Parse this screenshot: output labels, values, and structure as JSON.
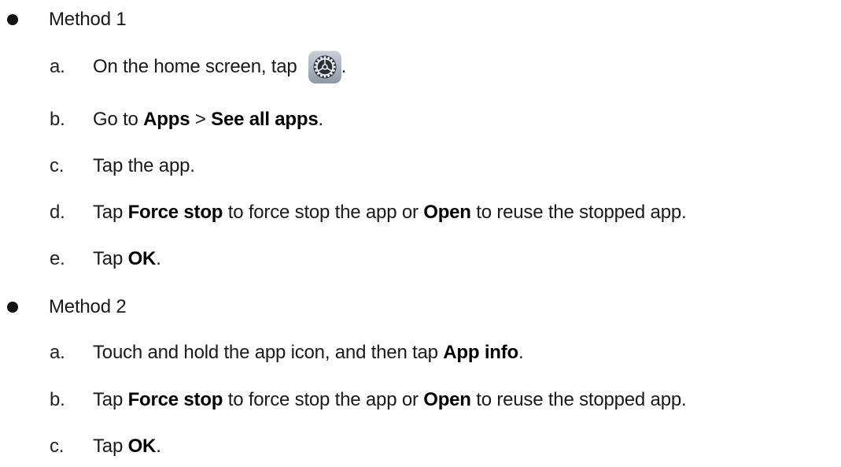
{
  "method1": {
    "label": "Method 1",
    "steps": [
      {
        "marker": "a.",
        "text": "On the home screen, tap",
        "after_icon": ".",
        "icon": "settings-icon"
      },
      {
        "marker": "b.",
        "parts": [
          "Go to ",
          "Apps",
          " > ",
          "See all apps",
          "."
        ]
      },
      {
        "marker": "c.",
        "text": "Tap the app."
      },
      {
        "marker": "d.",
        "parts": [
          "Tap ",
          "Force stop",
          " to force stop the app or ",
          "Open",
          " to reuse the stopped app."
        ]
      },
      {
        "marker": "e.",
        "parts": [
          "Tap ",
          "OK",
          "."
        ]
      }
    ]
  },
  "method2": {
    "label": "Method 2",
    "steps": [
      {
        "marker": "a.",
        "parts": [
          "Touch and hold the app icon, and then tap ",
          "App info",
          "."
        ]
      },
      {
        "marker": "b.",
        "parts": [
          "Tap ",
          "Force stop",
          " to force stop the app or ",
          "Open",
          " to reuse the stopped app."
        ]
      },
      {
        "marker": "c.",
        "parts": [
          "Tap ",
          "OK",
          "."
        ]
      }
    ]
  }
}
